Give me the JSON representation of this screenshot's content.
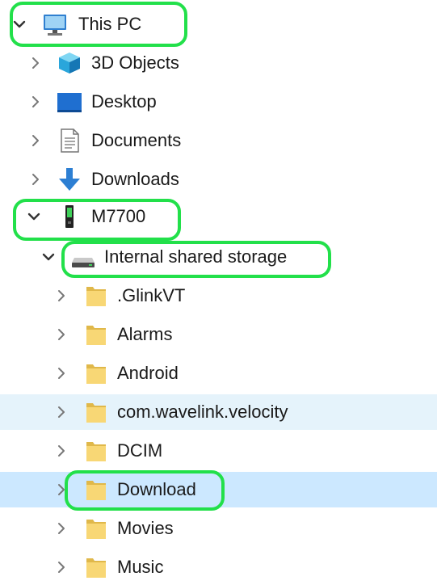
{
  "tree": {
    "this_pc": {
      "label": "This PC",
      "icon": "computer-icon",
      "expanded": true
    },
    "this_pc_children": [
      {
        "label": "3D Objects",
        "icon": "3d-objects-icon"
      },
      {
        "label": "Desktop",
        "icon": "desktop-icon"
      },
      {
        "label": "Documents",
        "icon": "documents-icon"
      },
      {
        "label": "Downloads",
        "icon": "downloads-icon"
      }
    ],
    "device": {
      "label": "M7700",
      "icon": "mobile-device-icon",
      "expanded": true
    },
    "storage": {
      "label": "Internal shared storage",
      "icon": "drive-icon",
      "expanded": true
    },
    "folders": [
      {
        "label": ".GlinkVT"
      },
      {
        "label": "Alarms"
      },
      {
        "label": "Android"
      },
      {
        "label": "com.wavelink.velocity",
        "state": "hover"
      },
      {
        "label": "DCIM"
      },
      {
        "label": "Download",
        "state": "selected"
      },
      {
        "label": "Movies"
      },
      {
        "label": "Music"
      }
    ]
  },
  "colors": {
    "highlight_outline": "#22e04a",
    "hover_bg": "#e5f3fb",
    "selected_bg": "#cce8ff",
    "folder_fill": "#f8d775",
    "downloads_arrow": "#2d7fd3"
  }
}
